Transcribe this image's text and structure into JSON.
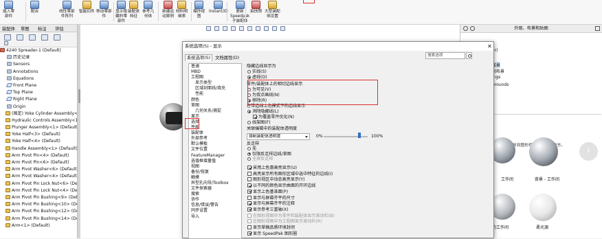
{
  "ribbon": {
    "buttons": [
      {
        "name": "insert-component-button",
        "label": "插入零\n部件"
      },
      {
        "name": "mate-button",
        "label": "配合"
      },
      {
        "name": "linear-pattern-button",
        "label": "线性零部\n件阵列"
      },
      {
        "name": "smart-fasteners-button",
        "label": "智能扣件"
      },
      {
        "name": "move-component-button",
        "label": "移动零部\n件"
      },
      {
        "name": "show-hidden-components-button",
        "label": "显示隐\n藏的零\n部件"
      },
      {
        "name": "assembly-features-button",
        "label": "装配体\n特征"
      },
      {
        "name": "reference-geometry-button",
        "label": "参考几\n何体"
      },
      {
        "name": "new-motion-study-button",
        "label": "新建运\n动算例"
      },
      {
        "name": "bill-of-materials-button",
        "label": "材料明\n细表"
      },
      {
        "name": "exploded-view-button",
        "label": "爆炸视\n图"
      },
      {
        "name": "instant3d-button",
        "label": "Instant3D"
      },
      {
        "name": "update-speedpak-button",
        "label": "更新\nSpeedpak\n子装配体"
      },
      {
        "name": "take-snapshot-button",
        "label": "拍快照"
      },
      {
        "name": "large-assembly-settings-button",
        "label": "大型装配\n体设置"
      }
    ]
  },
  "panel_tabs": [
    "装配体",
    "草图",
    "标注",
    "评估"
  ],
  "tree": {
    "root": "4240 Spreader-1 (Default)",
    "items": [
      "历史记录",
      "Sensors",
      "Annotations",
      "Equations",
      "Front Plane",
      "Top Plane",
      "Right Plane",
      "Origin",
      "(固定) Yoke Cylinder Assembly<",
      "Hydraulic Controls Assembly<1",
      "Plunger Assembly<1> (Default)",
      "Yoke Half<3> (Default)",
      "Yoke Half<4> (Default)",
      "Handle Assembly<1> (Default)",
      "Arm Pivot Pin<4> (Default)",
      "Arm Pivot Pin<6> (Default)",
      "Arm Pivot Washer<6> (Default)",
      "Arm Pivot Washer<4> (Default)",
      "Arm Pivot Pin Lock Nut<6> (Def",
      "Arm Pivot Pin Lock Nut<4> (Def",
      "Arm Pivot Pin Bushing<9> (Defa",
      "Arm Pivot Pin Bushing<10> (Default",
      "Arm Pivot Pin Bushing<12> (Default",
      "Arm Pivot Pin Bushing<14> (Default",
      "Arm<1> (Default)"
    ]
  },
  "right_panel": {
    "title": "外观、布景和贴图",
    "list": [
      "or)",
      "布景",
      "间布景",
      "ings",
      "grounds"
    ],
    "note": "将布景拖放到图形视图中的任何地方。",
    "thumb_labels": [
      "工作间",
      "背景 - 工作间",
      "的工作间",
      "柔光源"
    ],
    "next_label": "›"
  },
  "dialog": {
    "title": "系统选项(S) - 显示",
    "close": "✕",
    "tabs": [
      "系统选项(S)",
      "文档属性(D)"
    ],
    "search_placeholder": "搜索选项",
    "nav": [
      {
        "label": "普通",
        "sub": false
      },
      {
        "label": "MBD",
        "sub": false
      },
      {
        "label": "工程图",
        "sub": false
      },
      {
        "label": "显示类型",
        "sub": true
      },
      {
        "label": "区域剖面线/填充",
        "sub": true
      },
      {
        "label": "性能",
        "sub": true
      },
      {
        "label": "颜色",
        "sub": false
      },
      {
        "label": "草图",
        "sub": false
      },
      {
        "label": "几何关系/捕捉",
        "sub": true
      },
      {
        "label": "显示",
        "sub": false
      },
      {
        "label": "选择",
        "sub": false
      },
      {
        "label": "性能",
        "sub": false
      },
      {
        "label": "装配体",
        "sub": false
      },
      {
        "label": "外部参考",
        "sub": false
      },
      {
        "label": "默认模板",
        "sub": false
      },
      {
        "label": "文件位置",
        "sub": false
      },
      {
        "label": "FeatureManager",
        "sub": false
      },
      {
        "label": "选值框增量值",
        "sub": false
      },
      {
        "label": "视图",
        "sub": false
      },
      {
        "label": "备份/恢复",
        "sub": false
      },
      {
        "label": "触摸",
        "sub": false
      },
      {
        "label": "异型孔向导/Toolbox",
        "sub": false
      },
      {
        "label": "文件探索器",
        "sub": false
      },
      {
        "label": "搜索",
        "sub": false
      },
      {
        "label": "协作",
        "sub": false
      },
      {
        "label": "信息/错误/警告",
        "sub": false
      },
      {
        "label": "同步设置",
        "sub": false
      },
      {
        "label": "导入",
        "sub": false
      }
    ],
    "hidden_edges": {
      "label": "隐藏边线显示为",
      "options": [
        "实线(S)",
        "虚线(D)"
      ],
      "selected": 1
    },
    "part_edges": {
      "label": "零件/装配体上的相切边线显示",
      "options": [
        "为可见(V)",
        "为双点画线(N)",
        "移除(R)"
      ],
      "selected": 2
    },
    "shaded_edges": {
      "label": "在带边线上色模式下的边线显示",
      "opt1": "消除隐藏线(L)",
      "chk": "为覆盖零件优化(N)",
      "opt2": "线架图(F)"
    },
    "transparency": {
      "label": "关联编辑中的装配体透明度",
      "select": "强制装配体透明度",
      "min": "0%",
      "max": "100%",
      "value": 82
    },
    "anti_alias": {
      "label": "反走样",
      "options": [
        "无",
        "仅限反走样边线/草图",
        "全屏反走样"
      ],
      "selected": 1
    },
    "checks": [
      {
        "label": "采用上色惠高亮显示(U)",
        "checked": true,
        "disabled": false
      },
      {
        "label": "高亮显示所有图形区域中选中特征的边线(I)",
        "checked": false,
        "disabled": false
      },
      {
        "label": "图形视区中动态高亮显示(Y)",
        "checked": false,
        "disabled": false
      },
      {
        "label": "以不同的颜色显示曲面的开环边线",
        "checked": true,
        "disabled": false
      },
      {
        "label": "显示上色基准面(P)",
        "checked": true,
        "disabled": false
      },
      {
        "label": "显示与屏幕齐平的尺寸",
        "checked": false,
        "disabled": false
      },
      {
        "label": "显示与屏幕齐平的注释",
        "checked": true,
        "disabled": false
      },
      {
        "label": "显示参考三重轴(X)",
        "checked": true,
        "disabled": false
      },
      {
        "label": "在图形视图中为零件和装配体显示滚动栏(B)",
        "checked": false,
        "disabled": true
      },
      {
        "label": "在图形视图中为工程图显示滚动栏(R)",
        "checked": false,
        "disabled": true
      },
      {
        "label": "显示草稿品质环境封闭",
        "checked": false,
        "disabled": false
      },
      {
        "label": "显示 SpeedPak 图形圈",
        "checked": true,
        "disabled": false
      }
    ]
  }
}
